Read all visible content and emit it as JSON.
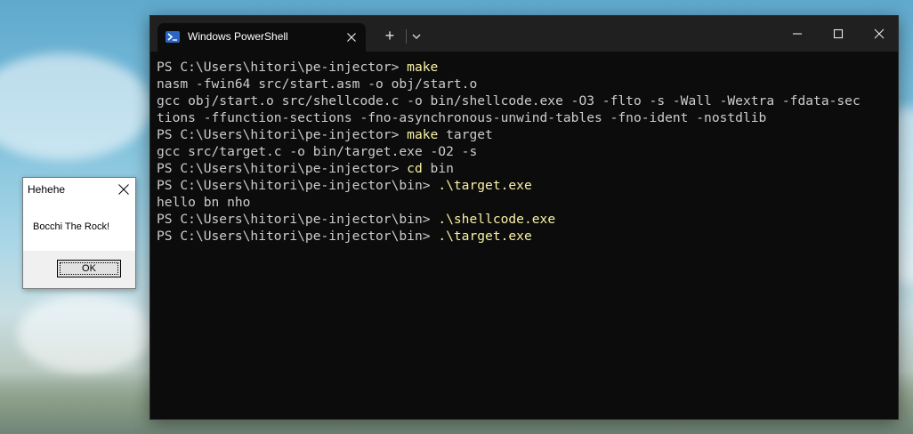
{
  "terminal": {
    "tab_title": "Windows PowerShell",
    "tab_icon": "powershell-icon",
    "new_tab_label": "+",
    "lines": [
      {
        "prompt": "PS C:\\Users\\hitori\\pe-injector> ",
        "cmd": "make",
        "rest": ""
      },
      {
        "prompt": "",
        "cmd": "",
        "rest": "nasm -fwin64 src/start.asm -o obj/start.o"
      },
      {
        "prompt": "",
        "cmd": "",
        "rest": "gcc obj/start.o src/shellcode.c -o bin/shellcode.exe -O3 -flto -s -Wall -Wextra -fdata-sec"
      },
      {
        "prompt": "",
        "cmd": "",
        "rest": "tions -ffunction-sections -fno-asynchronous-unwind-tables -fno-ident -nostdlib"
      },
      {
        "prompt": "PS C:\\Users\\hitori\\pe-injector> ",
        "cmd": "make",
        "rest": " target"
      },
      {
        "prompt": "",
        "cmd": "",
        "rest": "gcc src/target.c -o bin/target.exe -O2 -s"
      },
      {
        "prompt": "PS C:\\Users\\hitori\\pe-injector> ",
        "cmd": "cd",
        "rest": " bin"
      },
      {
        "prompt": "PS C:\\Users\\hitori\\pe-injector\\bin> ",
        "cmd": ".\\target.exe",
        "rest": ""
      },
      {
        "prompt": "",
        "cmd": "",
        "rest": "hello bn nho"
      },
      {
        "prompt": "PS C:\\Users\\hitori\\pe-injector\\bin> ",
        "cmd": ".\\shellcode.exe",
        "rest": ""
      },
      {
        "prompt": "PS C:\\Users\\hitori\\pe-injector\\bin> ",
        "cmd": ".\\target.exe",
        "rest": ""
      }
    ],
    "colors": {
      "background": "#0c0c0c",
      "text": "#cccccc",
      "command": "#f9f1a5",
      "titlebar": "#202020"
    }
  },
  "msgbox": {
    "title": "Hehehe",
    "message": "Bocchi The Rock!",
    "ok_label": "OK"
  }
}
